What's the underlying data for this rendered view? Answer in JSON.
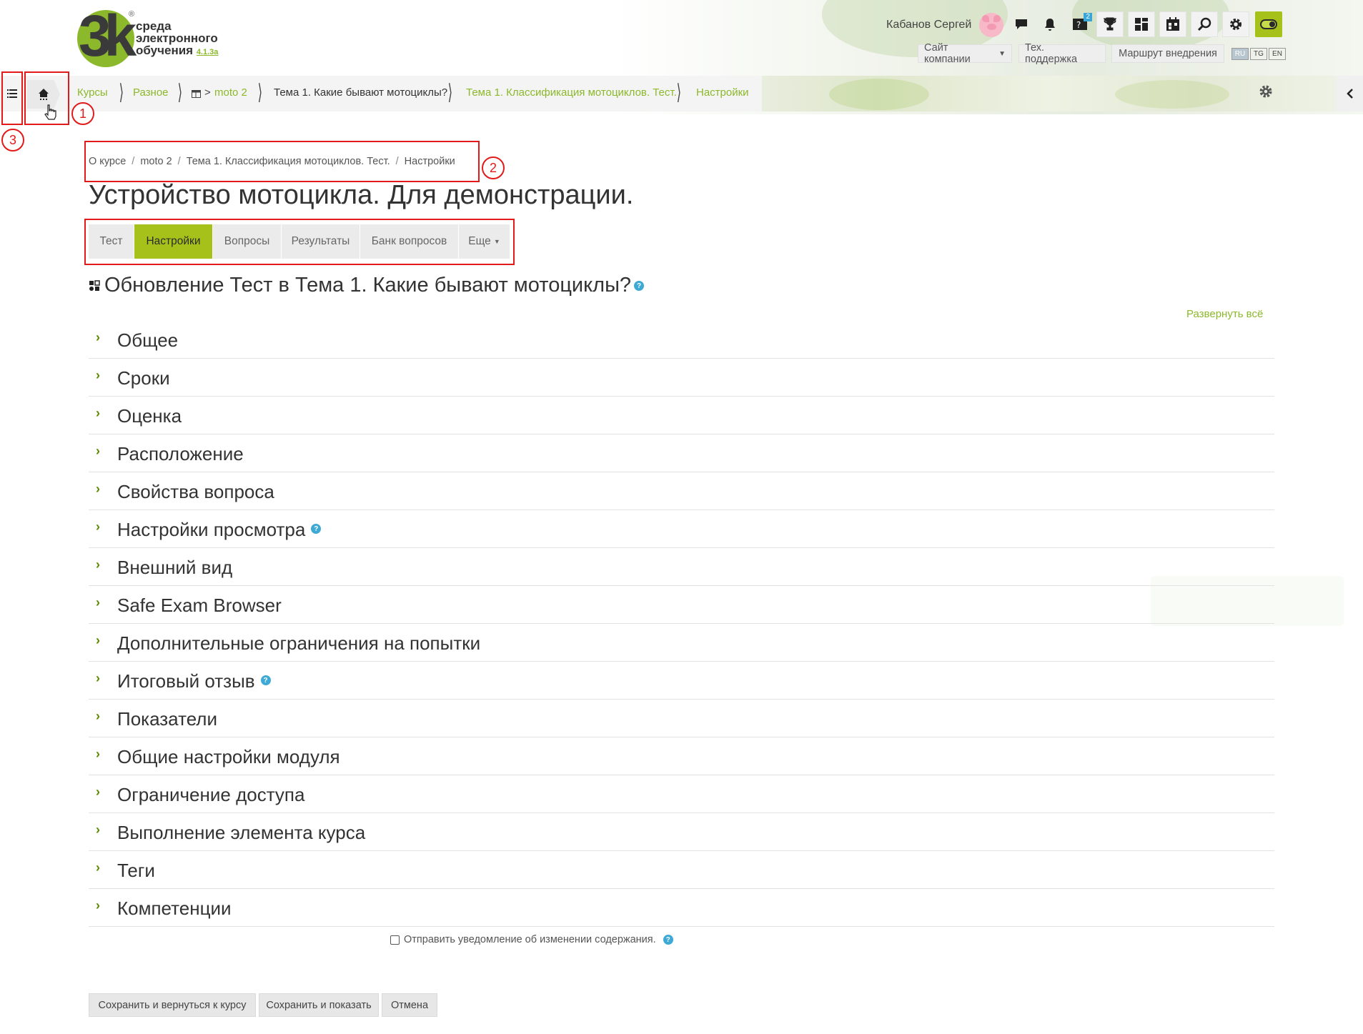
{
  "logo": {
    "line1": "среда",
    "line2": "электронного",
    "line3": "обучения",
    "version": "4.1.3a",
    "reg": "®",
    "number": "3k"
  },
  "header": {
    "user_name": "Кабанов Сергей",
    "icons": [
      "chat-icon",
      "bell-icon",
      "help-badge-icon",
      "trophy-icon",
      "dashboard-icon",
      "calendar-icon",
      "search-icon",
      "gear-icon",
      "theme-toggle-icon"
    ],
    "help_badge_count": "2",
    "buttons": {
      "company_site": "Сайт компании",
      "support": "Тех. поддержка",
      "route": "Маршрут внедрения"
    },
    "languages": [
      "RU",
      "TG",
      "EN"
    ],
    "active_language": "RU"
  },
  "crumbs": {
    "items": [
      {
        "label": "Курсы"
      },
      {
        "label": "Разное"
      },
      {
        "label": "moto 2"
      },
      {
        "label": "Тема 1. Какие бывают мотоциклы?"
      },
      {
        "label": "Тема 1. Классификация мотоциклов. Тест."
      },
      {
        "label": "Настройки"
      }
    ]
  },
  "annotations": [
    "1",
    "2",
    "3"
  ],
  "path": {
    "items": [
      "О курсе",
      "moto 2",
      "Тема 1. Классификация мотоциклов. Тест.",
      "Настройки"
    ],
    "separator": "/"
  },
  "page_title": "Устройство мотоцикла. Для демонстрации.",
  "tabs": [
    {
      "label": "Тест",
      "active": false
    },
    {
      "label": "Настройки",
      "active": true
    },
    {
      "label": "Вопросы",
      "active": false
    },
    {
      "label": "Результаты",
      "active": false
    },
    {
      "label": "Банк вопросов",
      "active": false
    },
    {
      "label": "Еще",
      "active": false
    }
  ],
  "update_heading": "Обновление Тест в Тема 1. Какие бывают мотоциклы?",
  "expand_all": "Развернуть всё",
  "sections": [
    {
      "label": "Общее",
      "help": false
    },
    {
      "label": "Сроки",
      "help": false
    },
    {
      "label": "Оценка",
      "help": false
    },
    {
      "label": "Расположение",
      "help": false
    },
    {
      "label": "Свойства вопроса",
      "help": false
    },
    {
      "label": "Настройки просмотра",
      "help": true
    },
    {
      "label": "Внешний вид",
      "help": false
    },
    {
      "label": "Safe Exam Browser",
      "help": false
    },
    {
      "label": "Дополнительные ограничения на попытки",
      "help": false
    },
    {
      "label": "Итоговый отзыв",
      "help": true
    },
    {
      "label": "Показатели",
      "help": false
    },
    {
      "label": "Общие настройки модуля",
      "help": false
    },
    {
      "label": "Ограничение доступа",
      "help": false
    },
    {
      "label": "Выполнение элемента курса",
      "help": false
    },
    {
      "label": "Теги",
      "help": false
    },
    {
      "label": "Компетенции",
      "help": false
    }
  ],
  "notify_label": "Отправить уведомление об изменении содержания.",
  "notify_checked": false,
  "buttons": {
    "save_return": "Сохранить и вернуться к курсу",
    "save_show": "Сохранить и показать",
    "cancel": "Отмена"
  },
  "colors": {
    "accent": "#a6c21a",
    "link": "#8cb82b",
    "annotation": "#e21a1a",
    "help": "#3fa9d6"
  }
}
